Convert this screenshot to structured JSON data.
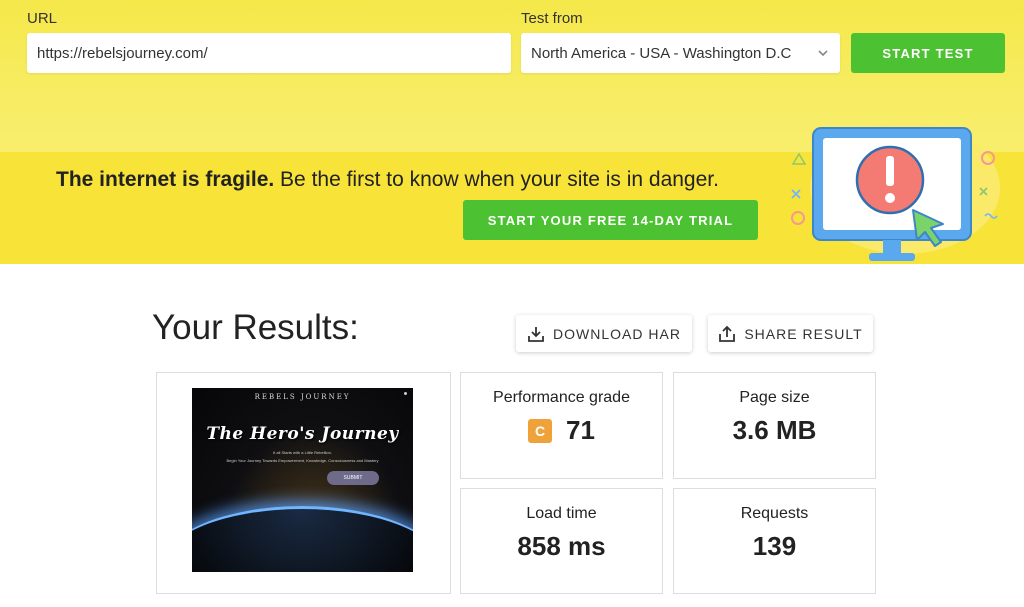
{
  "test_bar": {
    "url_label": "URL",
    "url_value": "https://rebelsjourney.com/",
    "test_from_label": "Test from",
    "test_from_value": "North America - USA - Washington D.C",
    "start_button": "START TEST"
  },
  "banner": {
    "headline_bold": "The internet is fragile.",
    "headline_rest": " Be the first to know when your site is in danger.",
    "trial_button": "START YOUR FREE 14-DAY TRIAL"
  },
  "results": {
    "title": "Your Results:",
    "download_har": "DOWNLOAD HAR",
    "share_result": "SHARE RESULT",
    "screenshot": {
      "site_name": "REBELS JOURNEY",
      "hero_title": "The Hero's Journey",
      "tagline": "It all Starts with a Little Rebellion.",
      "subline": "Begin Your Journey Towards Empowerment, Knowledge, Consciousness and Mastery",
      "button": "SUBMIT"
    },
    "performance": {
      "label": "Performance grade",
      "grade": "C",
      "score": "71",
      "grade_color": "#f0a23a"
    },
    "page_size": {
      "label": "Page size",
      "value": "3.6 MB"
    },
    "load_time": {
      "label": "Load time",
      "value": "858 ms"
    },
    "requests": {
      "label": "Requests",
      "value": "139"
    }
  },
  "colors": {
    "accent_green": "#4cc131",
    "banner_yellow": "#f8e339",
    "top_yellow": "#f5e84a"
  },
  "icons": [
    "chevron-down-icon",
    "download-icon",
    "share-icon",
    "monitor-alert-icon"
  ]
}
